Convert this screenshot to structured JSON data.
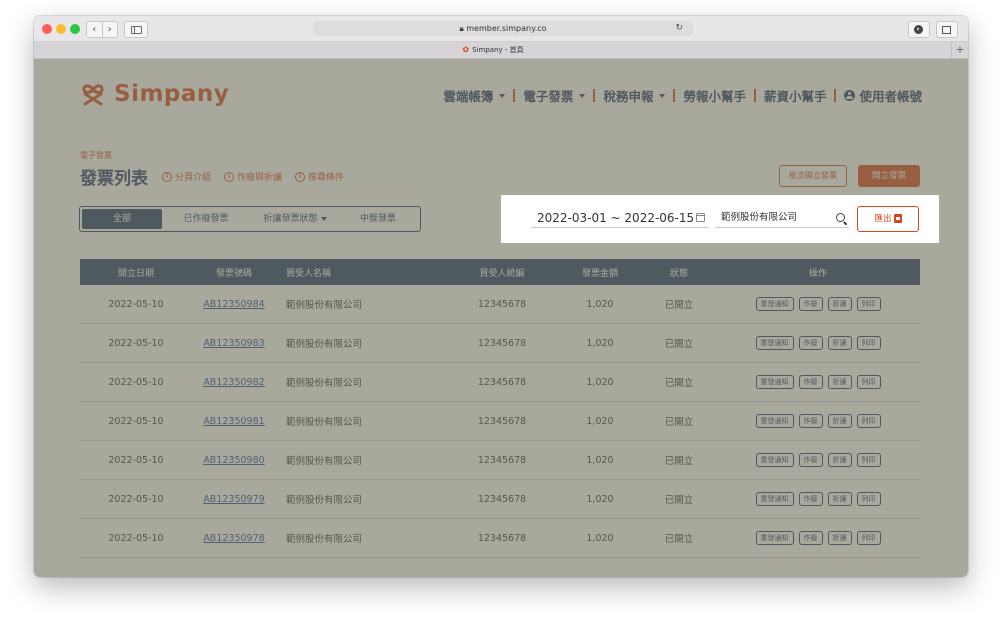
{
  "browser": {
    "url": "member.simpany.co",
    "tab_title": "Simpany - 首頁",
    "newtab_label": "+"
  },
  "brand": {
    "name": "Simpany",
    "accent": "#d5461b",
    "navy": "#1d3b66"
  },
  "nav": {
    "items": [
      {
        "label": "雲端帳簿",
        "has_dropdown": true
      },
      {
        "label": "電子發票",
        "has_dropdown": true
      },
      {
        "label": "稅務申報",
        "has_dropdown": true
      },
      {
        "label": "勞報小幫手",
        "has_dropdown": false
      },
      {
        "label": "薪資小幫手",
        "has_dropdown": false
      }
    ],
    "user_label": "使用者帳號"
  },
  "page": {
    "breadcrumb": "電子發票",
    "title": "發票列表",
    "help_links": [
      "分頁介紹",
      "作廢與折讓",
      "搜尋條件"
    ]
  },
  "actions": {
    "batch_label": "批次開立發票",
    "open_label": "開立發票",
    "export_label": "匯出"
  },
  "filter_tabs": [
    {
      "label": "全部",
      "active": true
    },
    {
      "label": "已作廢發票",
      "active": false
    },
    {
      "label": "折讓發票狀態",
      "active": false,
      "has_dropdown": true
    },
    {
      "label": "中獎發票",
      "active": false
    }
  ],
  "search": {
    "date_range": "2022-03-01 ~ 2022-06-15",
    "company": "範例股份有限公司"
  },
  "table": {
    "columns": [
      "開立日期",
      "發票號碼",
      "買受人名稱",
      "買受人統編",
      "發票金額",
      "狀態",
      "操作"
    ],
    "row_actions": [
      "重發通知",
      "作廢",
      "折讓",
      "列印"
    ],
    "rows": [
      {
        "date": "2022-05-10",
        "number": "AB12350984",
        "buyer": "範例股份有限公司",
        "tax_id": "12345678",
        "amount": "1,020",
        "status": "已開立"
      },
      {
        "date": "2022-05-10",
        "number": "AB12350983",
        "buyer": "範例股份有限公司",
        "tax_id": "12345678",
        "amount": "1,020",
        "status": "已開立"
      },
      {
        "date": "2022-05-10",
        "number": "AB12350982",
        "buyer": "範例股份有限公司",
        "tax_id": "12345678",
        "amount": "1,020",
        "status": "已開立"
      },
      {
        "date": "2022-05-10",
        "number": "AB12350981",
        "buyer": "範例股份有限公司",
        "tax_id": "12345678",
        "amount": "1,020",
        "status": "已開立"
      },
      {
        "date": "2022-05-10",
        "number": "AB12350980",
        "buyer": "範例股份有限公司",
        "tax_id": "12345678",
        "amount": "1,020",
        "status": "已開立"
      },
      {
        "date": "2022-05-10",
        "number": "AB12350979",
        "buyer": "範例股份有限公司",
        "tax_id": "12345678",
        "amount": "1,020",
        "status": "已開立"
      },
      {
        "date": "2022-05-10",
        "number": "AB12350978",
        "buyer": "範例股份有限公司",
        "tax_id": "12345678",
        "amount": "1,020",
        "status": "已開立"
      }
    ]
  }
}
